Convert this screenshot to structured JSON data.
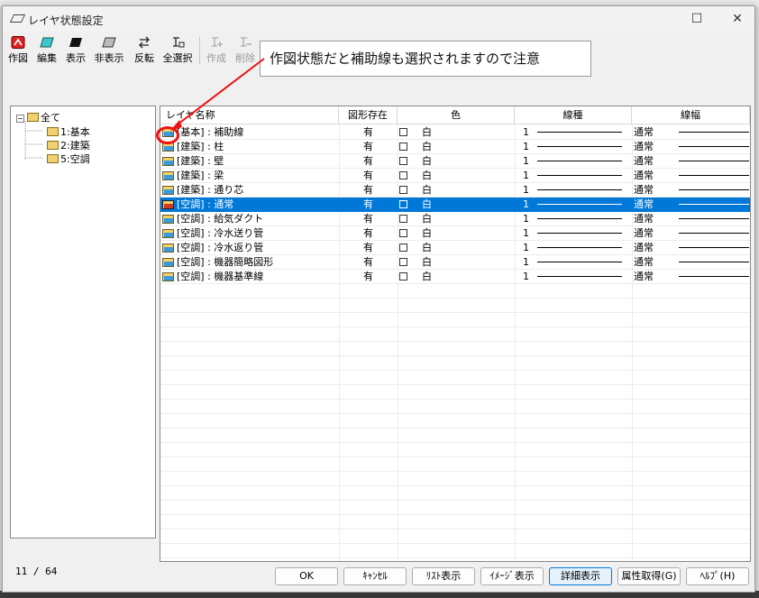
{
  "window": {
    "title": "レイヤ状態設定"
  },
  "toolbar": [
    {
      "label": "作図",
      "icon": "draw-icon",
      "enabled": true
    },
    {
      "label": "編集",
      "icon": "edit-icon",
      "enabled": true
    },
    {
      "label": "表示",
      "icon": "show-icon",
      "enabled": true
    },
    {
      "label": "非表示",
      "icon": "hide-icon",
      "enabled": true
    },
    {
      "label": "反転",
      "icon": "invert-icon",
      "enabled": true
    },
    {
      "label": "全選択",
      "icon": "select-all-icon",
      "enabled": true
    },
    {
      "label": "作成",
      "icon": "create-icon",
      "enabled": false
    },
    {
      "label": "削除",
      "icon": "delete-icon",
      "enabled": false
    }
  ],
  "tooltip": "作図状態だと補助線も選択されますので注意",
  "tree": {
    "root": "全て",
    "children": [
      "1:基本",
      "2:建築",
      "5:空調"
    ]
  },
  "columns": [
    "レイヤ名称",
    "図形存在",
    "色",
    "線種",
    "線幅"
  ],
  "rows": [
    {
      "name": "[基本] : 補助線",
      "exists": "有",
      "color": "白",
      "ltype": "1",
      "lwidth": "通常",
      "selected": false
    },
    {
      "name": "[建築] : 柱",
      "exists": "有",
      "color": "白",
      "ltype": "1",
      "lwidth": "通常",
      "selected": false
    },
    {
      "name": "[建築] : 壁",
      "exists": "有",
      "color": "白",
      "ltype": "1",
      "lwidth": "通常",
      "selected": false
    },
    {
      "name": "[建築] : 梁",
      "exists": "有",
      "color": "白",
      "ltype": "1",
      "lwidth": "通常",
      "selected": false
    },
    {
      "name": "[建築] : 通り芯",
      "exists": "有",
      "color": "白",
      "ltype": "1",
      "lwidth": "通常",
      "selected": false
    },
    {
      "name": "[空調] : 通常",
      "exists": "有",
      "color": "白",
      "ltype": "1",
      "lwidth": "通常",
      "selected": true
    },
    {
      "name": "[空調] : 給気ダクト",
      "exists": "有",
      "color": "白",
      "ltype": "1",
      "lwidth": "通常",
      "selected": false
    },
    {
      "name": "[空調] : 冷水送り管",
      "exists": "有",
      "color": "白",
      "ltype": "1",
      "lwidth": "通常",
      "selected": false
    },
    {
      "name": "[空調] : 冷水返り管",
      "exists": "有",
      "color": "白",
      "ltype": "1",
      "lwidth": "通常",
      "selected": false
    },
    {
      "name": "[空調] : 機器簡略図形",
      "exists": "有",
      "color": "白",
      "ltype": "1",
      "lwidth": "通常",
      "selected": false
    },
    {
      "name": "[空調] : 機器基準線",
      "exists": "有",
      "color": "白",
      "ltype": "1",
      "lwidth": "通常",
      "selected": false
    }
  ],
  "status": {
    "count": "11 / 64"
  },
  "buttons": {
    "ok": "OK",
    "cancel": "ｷｬﾝｾﾙ",
    "list_view": "ﾘｽﾄ表示",
    "image_view": "ｲﾒｰｼﾞ表示",
    "detail_view": "詳細表示",
    "get_attr": "属性取得(G)",
    "help": "ﾍﾙﾌﾟ(H)"
  },
  "colors": {
    "selection": "#0078d7",
    "annotation": "#ee1111"
  }
}
